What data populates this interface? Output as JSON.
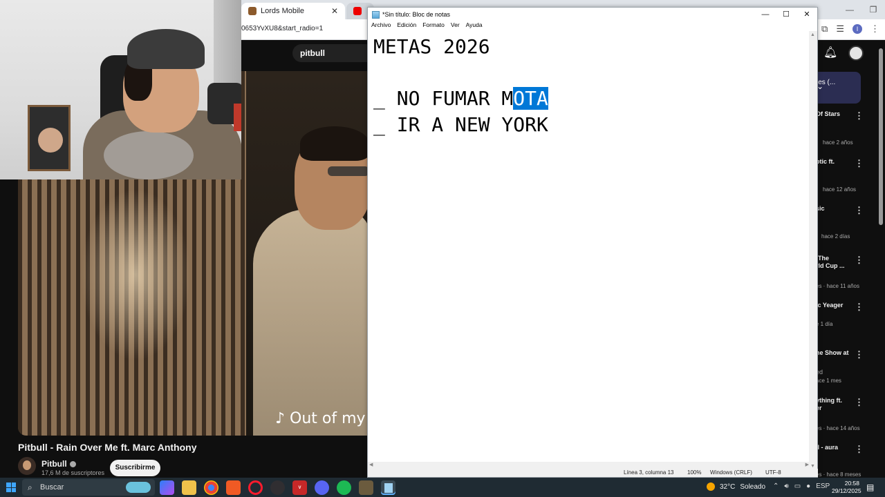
{
  "browser": {
    "tab_lords": "Lords Mobile",
    "url_fragment": "0653YvXU8&start_radio=1",
    "search_query": "pitbull"
  },
  "video": {
    "caption": "♪ Out of my m",
    "title": "Pitbull - Rain Over Me ft. Marc Anthony",
    "channel": "Pitbull",
    "subscribers": "17,6 M de suscriptores",
    "subscribe_label": "Suscribirme"
  },
  "sidebar": {
    "playlist_label": "ies (...",
    "items": [
      {
        "title": "Of Stars",
        "meta": "hace 2 años"
      },
      {
        "title": "otic ft.",
        "meta": "hace 12 años"
      },
      {
        "title": "sic",
        "meta": "hace 2 días"
      },
      {
        "title": "[The",
        "title2": "rld Cup ...",
        "meta": "es · hace 11 años"
      },
      {
        "title": "ic Yeager",
        "meta": "e 1 día"
      },
      {
        "title": "ne Show at",
        "title2": "ed",
        "meta": "ace 1 mes"
      },
      {
        "title": "ything ft.",
        "title2": "er",
        "meta": "es · hace 14 años"
      },
      {
        "title": "ll - aura",
        "meta": "es · hace 8 meses"
      }
    ]
  },
  "notepad": {
    "title": "*Sin título: Bloc de notas",
    "menu": [
      "Archivo",
      "Edición",
      "Formato",
      "Ver",
      "Ayuda"
    ],
    "lines": {
      "l1": "METAS 2026",
      "l3_pre": "_ NO FUMAR M",
      "l3_sel": "OTA",
      "l4": "_ IR A NEW YORK"
    },
    "status": {
      "position": "Línea 3, columna 13",
      "zoom": "100%",
      "eol": "Windows (CRLF)",
      "encoding": "UTF-8"
    }
  },
  "taskbar": {
    "search_label": "Buscar",
    "temperature": "32°C",
    "weather": "Soleado",
    "language": "ESP",
    "time": "20:58",
    "date": "29/12/2025"
  },
  "colors": {
    "selection": "#0078d7",
    "youtube_bg": "#0f0f0f",
    "taskbar": "#1f2b33"
  }
}
